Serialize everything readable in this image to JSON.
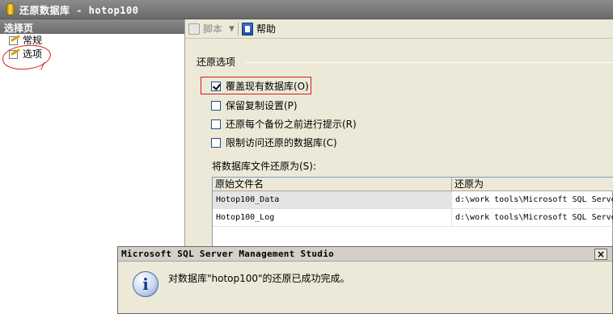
{
  "window": {
    "title": "还原数据库 - hotop100",
    "icon": "database-icon"
  },
  "sidebar": {
    "header": "选择页",
    "items": [
      {
        "label": "常规",
        "icon": "page-wand-icon"
      },
      {
        "label": "选项",
        "icon": "page-wand-icon"
      }
    ]
  },
  "toolbar": {
    "script_label": "脚本",
    "help_label": "帮助"
  },
  "options": {
    "group_label": "还原选项",
    "items": [
      {
        "label": "覆盖现有数据库(O)",
        "checked": true
      },
      {
        "label": "保留复制设置(P)",
        "checked": false
      },
      {
        "label": "还原每个备份之前进行提示(R)",
        "checked": false
      },
      {
        "label": "限制访问还原的数据库(C)",
        "checked": false
      }
    ]
  },
  "files": {
    "label": "将数据库文件还原为(S):",
    "columns": [
      "原始文件名",
      "还原为"
    ],
    "rows": [
      [
        "Hotop100_Data",
        "d:\\work tools\\Microsoft SQL Serve"
      ],
      [
        "Hotop100_Log",
        "d:\\work tools\\Microsoft SQL Serve"
      ]
    ]
  },
  "dialog": {
    "title": "Microsoft SQL Server Management Studio",
    "close_label": "×",
    "info_glyph": "i",
    "message": "对数据库\"hotop100\"的还原已成功完成。"
  },
  "colors": {
    "annotation_red": "#d01c1c",
    "title_bar": "#7a7a7a"
  }
}
